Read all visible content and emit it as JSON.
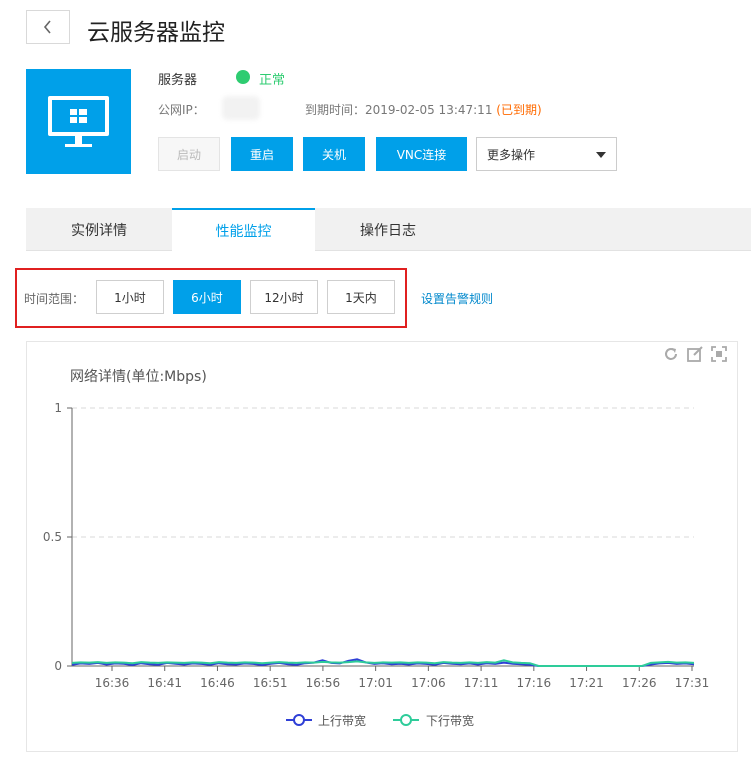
{
  "header": {
    "title": "云服务器监控",
    "back_icon": "chevron-left-icon"
  },
  "server": {
    "icon": "monitor-windows-icon",
    "label": "服务器",
    "status_text": "正常",
    "status_color": "#2ecc71",
    "ip_label": "公网IP：",
    "expire_label": "到期时间：2019-02-05 13:47:11 ",
    "expire_status": "(已到期)"
  },
  "actions": {
    "start": "启动",
    "restart": "重启",
    "shutdown": "关机",
    "vnc": "VNC连接",
    "more": "更多操作"
  },
  "tabs": [
    {
      "label": "实例详情",
      "active": false
    },
    {
      "label": "性能监控",
      "active": true
    },
    {
      "label": "操作日志",
      "active": false
    }
  ],
  "time_range": {
    "label": "时间范围：",
    "options": [
      {
        "label": "1小时",
        "active": false
      },
      {
        "label": "6小时",
        "active": true
      },
      {
        "label": "12小时",
        "active": false
      },
      {
        "label": "1天内",
        "active": false
      }
    ],
    "alert_link": "设置告警规则"
  },
  "colors": {
    "accent": "#00a0e9",
    "highlight_border": "#e02020",
    "expired": "#ff6a00"
  },
  "chart_data": {
    "type": "line",
    "title": "网络详情(单位:Mbps)",
    "xlabel": "",
    "ylabel": "",
    "ylim": [
      0,
      1
    ],
    "yticks": [
      0,
      0.5,
      1
    ],
    "yticklabels": [
      "0",
      "0.5",
      "1"
    ],
    "x_ticks": [
      "16:36",
      "16:41",
      "16:46",
      "16:51",
      "16:56",
      "17:01",
      "17:06",
      "17:11",
      "17:16",
      "17:21",
      "17:26",
      "17:31"
    ],
    "grid": true,
    "legend_position": "bottom",
    "series": [
      {
        "name": "上行带宽",
        "color": "#2f3fd6",
        "values": [
          0.005,
          0.01,
          0.008,
          0.012,
          0.006,
          0.01,
          0.009,
          0.004,
          0.011,
          0.007,
          0.005,
          0.012,
          0.009,
          0.006,
          0.01,
          0.008,
          0.005,
          0.011,
          0.007,
          0.006,
          0.01,
          0.008,
          0.004,
          0.009,
          0.012,
          0.007,
          0.005,
          0.011,
          0.013,
          0.022,
          0.012,
          0.01,
          0.02,
          0.026,
          0.014,
          0.008,
          0.011,
          0.007,
          0.009,
          0.006,
          0.01,
          0.008,
          0.005,
          0.012,
          0.009,
          0.007,
          0.01,
          0.006,
          0.011,
          0.008,
          0.013,
          0.009,
          0.007,
          0.005,
          0,
          0,
          0,
          0,
          0,
          0,
          0,
          0,
          0,
          0,
          0,
          0,
          0,
          0.006,
          0.01,
          0.012,
          0.008,
          0.01,
          0.007
        ]
      },
      {
        "name": "下行带宽",
        "color": "#2ecc9a",
        "values": [
          0.012,
          0.014,
          0.013,
          0.015,
          0.012,
          0.014,
          0.013,
          0.011,
          0.015,
          0.013,
          0.012,
          0.014,
          0.013,
          0.012,
          0.014,
          0.013,
          0.011,
          0.015,
          0.013,
          0.012,
          0.014,
          0.013,
          0.011,
          0.013,
          0.015,
          0.013,
          0.012,
          0.014,
          0.013,
          0.016,
          0.014,
          0.013,
          0.015,
          0.018,
          0.014,
          0.012,
          0.014,
          0.013,
          0.014,
          0.012,
          0.014,
          0.013,
          0.011,
          0.015,
          0.013,
          0.012,
          0.014,
          0.012,
          0.015,
          0.013,
          0.022,
          0.014,
          0.012,
          0.011,
          0,
          0,
          0,
          0,
          0,
          0,
          0,
          0,
          0,
          0,
          0,
          0,
          0,
          0.012,
          0.014,
          0.016,
          0.013,
          0.014,
          0.012
        ]
      }
    ]
  }
}
